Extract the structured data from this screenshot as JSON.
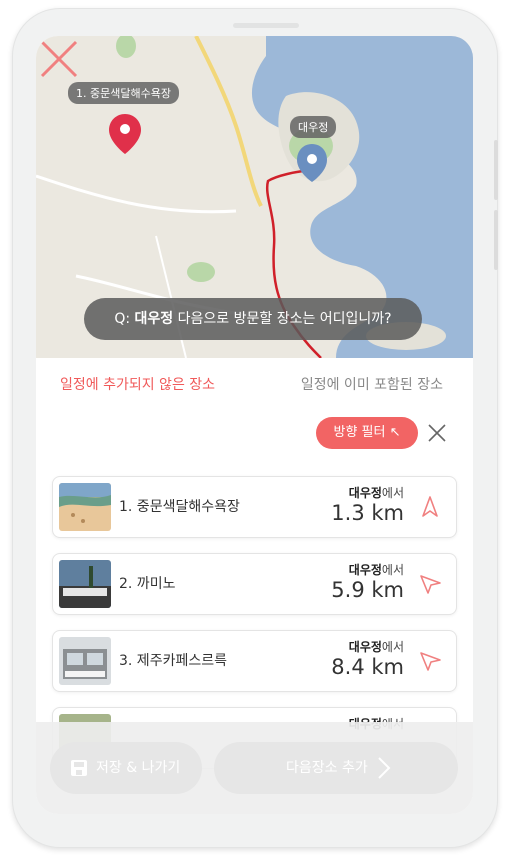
{
  "map": {
    "pin_start_label": "1. 중문색달해수욕장",
    "pin_current_label": "대우정",
    "question": {
      "prefix": "Q: ",
      "place": "대우정",
      "suffix": " 다음으로 방문할 장소는 어디입니까?"
    }
  },
  "tabs": {
    "active": "일정에 추가되지 않은 장소",
    "inactive": "일정에 이미 포함된 장소"
  },
  "filter": {
    "label": "방향 필터 ↖"
  },
  "places": [
    {
      "name": "1. 중문색달해수욕장",
      "from": "대우정",
      "from_suffix": "에서",
      "distance": "1.3 km"
    },
    {
      "name": "2. 까미노",
      "from": "대우정",
      "from_suffix": "에서",
      "distance": "5.9 km"
    },
    {
      "name": "3. 제주카페스르륵",
      "from": "대우정",
      "from_suffix": "에서",
      "distance": "8.4 km"
    },
    {
      "name": "",
      "from": "대우정",
      "from_suffix": "에서",
      "distance": ""
    }
  ],
  "footer": {
    "save_label": "저장 & 나가기",
    "next_label": "다음장소 추가"
  },
  "colors": {
    "accent": "#f26464",
    "sea": "#9cb8d8",
    "land": "#ebe8e0",
    "route": "#d0202a",
    "pin_red": "#e0304a",
    "pin_blue": "#6a8fc0"
  },
  "icons": [
    "close-icon",
    "map-pin-icon",
    "direction-arrow-icon",
    "save-icon",
    "chevron-right-icon"
  ]
}
